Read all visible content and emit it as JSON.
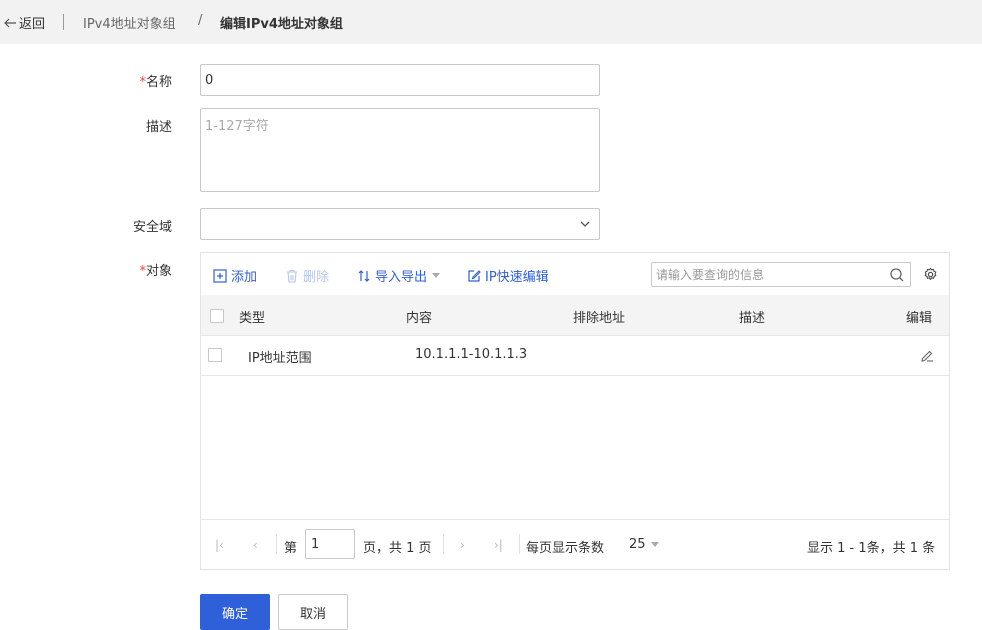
{
  "breadcrumb": {
    "back_label": "返回",
    "parent": "IPv4地址对象组",
    "separator": "/",
    "current": "编辑IPv4地址对象组"
  },
  "form": {
    "name": {
      "required_mark": "*",
      "label": "名称",
      "value": "0"
    },
    "description": {
      "label": "描述",
      "placeholder": "1-127字符"
    },
    "security_zone": {
      "label": "安全域",
      "value": ""
    },
    "objects": {
      "required_mark": "*",
      "label": "对象"
    }
  },
  "toolbar": {
    "add": "添加",
    "delete": "删除",
    "import_export": "导入导出",
    "quick_edit": "IP快速编辑",
    "search_placeholder": "请输入要查询的信息"
  },
  "table": {
    "columns": [
      "类型",
      "内容",
      "排除地址",
      "描述",
      "编辑"
    ],
    "rows": [
      {
        "type": "IP地址范围",
        "content": "10.1.1.1-10.1.1.3",
        "exclude": "",
        "description": ""
      }
    ]
  },
  "pagination": {
    "page_prefix": "第",
    "page_value": "1",
    "page_suffix": "页，共 1 页",
    "per_page_label": "每页显示条数",
    "per_page_value": "25",
    "summary": "显示 1 - 1条，共 1 条"
  },
  "actions": {
    "confirm": "确定",
    "cancel": "取消"
  },
  "colors": {
    "primary": "#2f5fd9",
    "required": "#e24b3b",
    "topbar_bg": "#f2f2f2"
  }
}
